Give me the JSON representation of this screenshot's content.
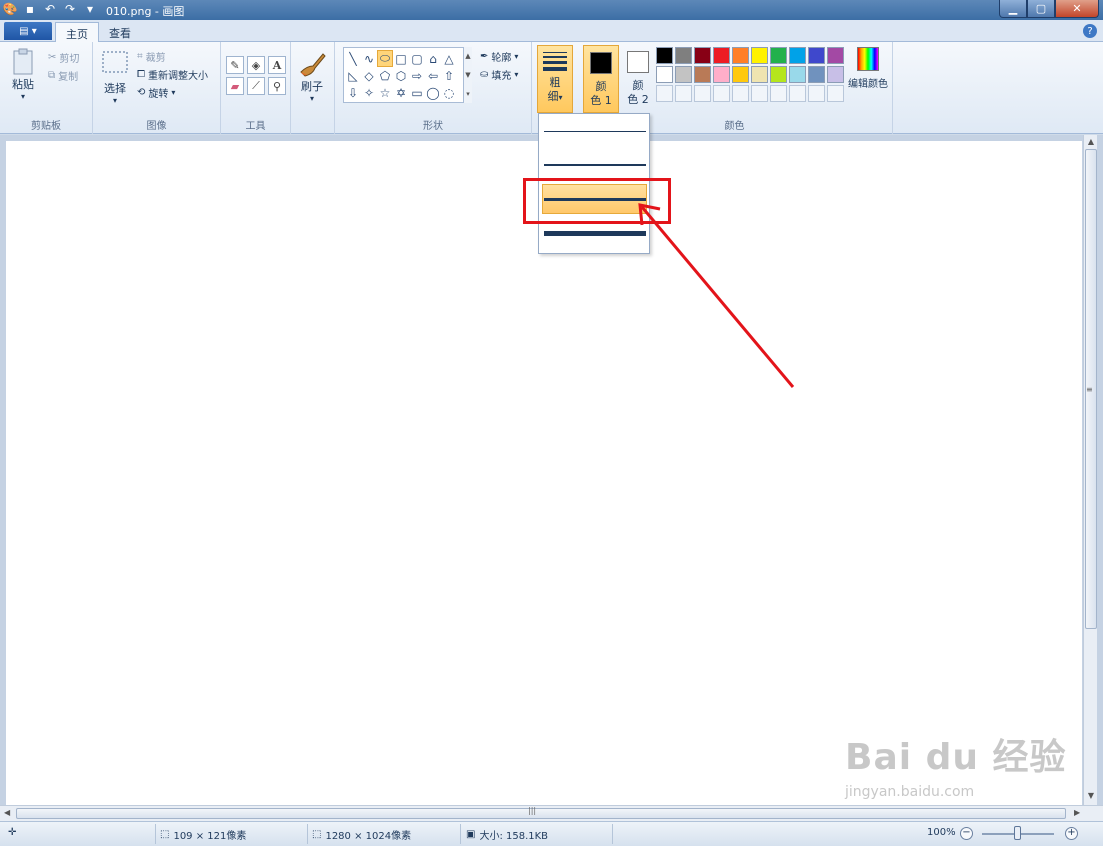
{
  "window": {
    "title": "010.png - 画图"
  },
  "tabs": [
    {
      "label": "主页",
      "active": true
    },
    {
      "label": "查看",
      "active": false
    }
  ],
  "clipboard": {
    "paste_label": "粘贴",
    "cut_label": "剪切",
    "copy_label": "复制",
    "group_label": "剪贴板"
  },
  "image": {
    "select_label": "选择",
    "crop_label": "裁剪",
    "resize_label": "重新调整大小",
    "rotate_label": "旋转",
    "group_label": "图像"
  },
  "tools": {
    "group_label": "工具",
    "items": [
      "pencil-icon",
      "fill-icon",
      "text-icon",
      "eraser-icon",
      "color-picker-icon",
      "magnifier-icon"
    ]
  },
  "brushes": {
    "label": "刷子"
  },
  "shapes": {
    "group_label": "形状",
    "outline_label": "轮廓",
    "fill_label": "填充",
    "glyphs": [
      "╲",
      "∿",
      "⬭",
      "□",
      "▢",
      "⌂",
      "△",
      "◺",
      "◇",
      "⬠",
      "⬡",
      "⇨",
      "⇦",
      "⇧",
      "⇩",
      "✧",
      "☆",
      "✡",
      "▭",
      "◯",
      "◌"
    ]
  },
  "size": {
    "label_line1": "粗",
    "label_line2": "细",
    "options_count": 4,
    "selected_index": 2
  },
  "colors": {
    "color1_line1": "颜",
    "color1_line2": "色 1",
    "color2_line1": "颜",
    "color2_line2": "色 2",
    "color1_value": "#000000",
    "color2_value": "#ffffff",
    "group_label": "颜色",
    "edit_colors_label": "编辑颜色",
    "palette_row1": [
      "#000000",
      "#7f7f7f",
      "#880015",
      "#ed1c24",
      "#ff7f27",
      "#fff200",
      "#22b14c",
      "#00a2e8",
      "#3f48cc",
      "#a349a4"
    ],
    "palette_row2": [
      "#ffffff",
      "#c3c3c3",
      "#b97a57",
      "#ffaec9",
      "#ffc90e",
      "#efe4b0",
      "#b5e61d",
      "#99d9ea",
      "#7092be",
      "#c8bfe7"
    ]
  },
  "status": {
    "selection_size": "109 × 121像素",
    "image_size": "1280 × 1024像素",
    "file_size": "大小: 158.1KB",
    "zoom": "100%"
  },
  "watermark": {
    "brand": "Bai du 经验",
    "url": "jingyan.baidu.com"
  }
}
